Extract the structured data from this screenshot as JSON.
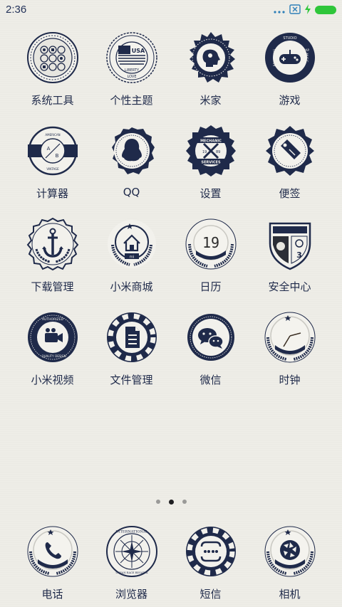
{
  "status_bar": {
    "time": "2:36",
    "colors": {
      "time": "#24335a",
      "battery": "#2fc63a",
      "icons": "#2e7fb8"
    }
  },
  "home": {
    "apps": [
      {
        "label": "系统工具",
        "icon": "tools-folder-icon"
      },
      {
        "label": "个性主题",
        "icon": "themes-badge-icon",
        "badge_text": [
          "USA",
          "LIBERTY",
          "LOVE"
        ]
      },
      {
        "label": "米家",
        "icon": "mijia-badge-icon"
      },
      {
        "label": "游戏",
        "icon": "gamepad-badge-icon",
        "badge_text": [
          "RECORDING",
          "STUDIO",
          "RAP",
          "MUSIC"
        ]
      },
      {
        "label": "计算器",
        "icon": "calculator-badge-icon",
        "badge_text": [
          "AMERICAN",
          "RETRO",
          "VINTAGE",
          "A",
          "B"
        ]
      },
      {
        "label": "QQ",
        "icon": "qq-penguin-icon"
      },
      {
        "label": "设置",
        "icon": "settings-mechanic-icon",
        "badge_text": [
          "MECHANIC",
          "SERVICES",
          "19",
          "89"
        ]
      },
      {
        "label": "便签",
        "icon": "notes-tag-icon"
      },
      {
        "label": "下载管理",
        "icon": "download-anchor-icon"
      },
      {
        "label": "小米商城",
        "icon": "mi-store-house-icon",
        "badge_text": [
          "mi"
        ]
      },
      {
        "label": "日历",
        "icon": "calendar-laurel-icon",
        "badge_text": [
          "19"
        ]
      },
      {
        "label": "安全中心",
        "icon": "security-shield-icon",
        "badge_text": [
          "3"
        ]
      },
      {
        "label": "小米视频",
        "icon": "video-camera-badge-icon",
        "badge_text": [
          "AUTHORIZED",
          "QUALITY",
          "DESIGN"
        ]
      },
      {
        "label": "文件管理",
        "icon": "file-chip-icon"
      },
      {
        "label": "微信",
        "icon": "wechat-chat-icon"
      },
      {
        "label": "时钟",
        "icon": "clock-laurel-icon"
      }
    ],
    "page_count": 3,
    "active_page": 2
  },
  "dock": {
    "apps": [
      {
        "label": "电话",
        "icon": "phone-laurel-icon"
      },
      {
        "label": "浏览器",
        "icon": "browser-compass-icon",
        "badge_text": [
          "INTERNATIONAL",
          "YACHTING CLUB",
          "OCEAN RACE REGATTA"
        ]
      },
      {
        "label": "短信",
        "icon": "message-chip-icon"
      },
      {
        "label": "相机",
        "icon": "camera-aperture-icon"
      }
    ]
  },
  "theme": {
    "navy": "#1f2a4a",
    "paper": "#eeede7"
  }
}
